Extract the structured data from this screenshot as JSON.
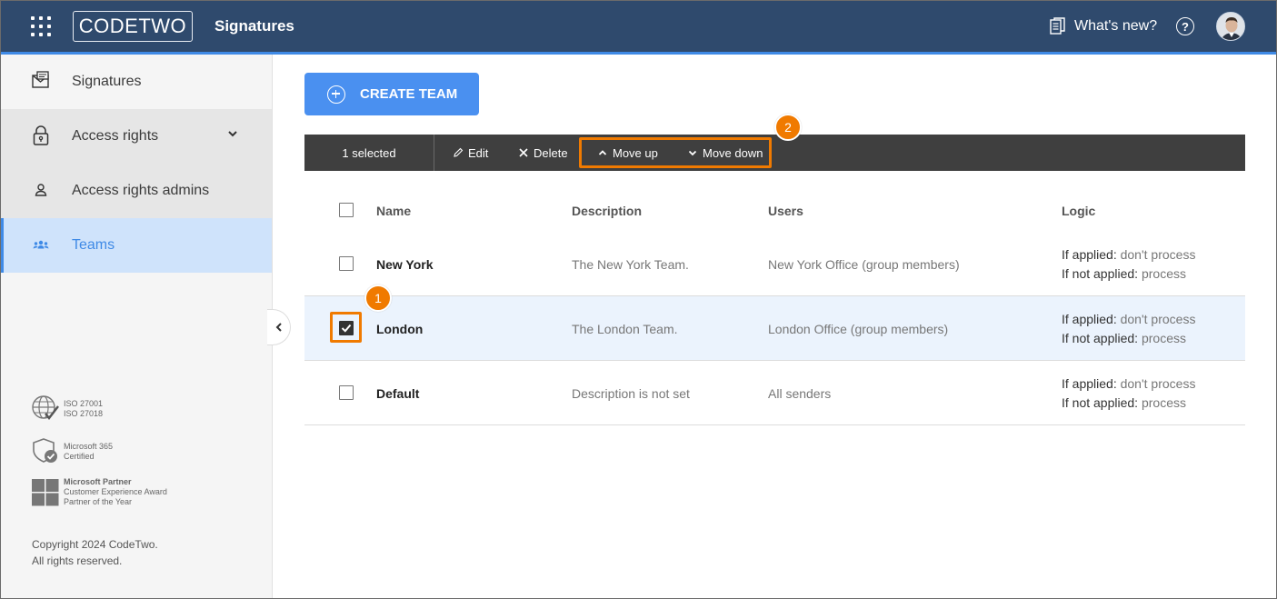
{
  "header": {
    "logo_text": "CODETWO",
    "app_title": "Signatures",
    "whats_new": "What's new?",
    "help_glyph": "?"
  },
  "sidebar": {
    "items": [
      {
        "label": "Signatures",
        "icon": "signature-icon"
      },
      {
        "label": "Access rights",
        "icon": "lock-icon"
      },
      {
        "label": "Access rights admins",
        "icon": "person-icon"
      },
      {
        "label": "Teams",
        "icon": "team-icon"
      }
    ],
    "badges": [
      {
        "lines": [
          "ISO 27001",
          "ISO 27018"
        ],
        "icon": "globe-check-icon"
      },
      {
        "lines": [
          "Microsoft 365",
          "Certified"
        ],
        "icon": "shield-check-icon"
      },
      {
        "lines": [
          "Microsoft Partner",
          "Customer Experience Award",
          "Partner of the Year"
        ],
        "icon": "microsoft-logo-icon"
      }
    ],
    "copyright_line1": "Copyright 2024 CodeTwo.",
    "copyright_line2": "All rights reserved."
  },
  "main": {
    "create_button": "CREATE TEAM",
    "toolbar": {
      "selected": "1 selected",
      "edit": "Edit",
      "delete": "Delete",
      "move_up": "Move up",
      "move_down": "Move down"
    },
    "callouts": [
      "1",
      "2"
    ],
    "table": {
      "columns": [
        "Name",
        "Description",
        "Users",
        "Logic"
      ],
      "rows": [
        {
          "name": "New York",
          "description": "The New York Team.",
          "users": "New York Office (group members)",
          "checked": false,
          "logic_applied_label": "If applied:",
          "logic_applied_value": "don't process",
          "logic_not_applied_label": "If not applied:",
          "logic_not_applied_value": "process"
        },
        {
          "name": "London",
          "description": "The London Team.",
          "users": "London Office (group members)",
          "checked": true,
          "logic_applied_label": "If applied:",
          "logic_applied_value": "don't process",
          "logic_not_applied_label": "If not applied:",
          "logic_not_applied_value": "process"
        },
        {
          "name": "Default",
          "description": "Description is not set",
          "users": "All senders",
          "checked": false,
          "logic_applied_label": "If applied:",
          "logic_applied_value": "don't process",
          "logic_not_applied_label": "If not applied:",
          "logic_not_applied_value": "process"
        }
      ]
    }
  },
  "colors": {
    "header_bg": "#2f4a6d",
    "accent": "#3f8ae6",
    "highlight": "#f07a00",
    "toolbar_bg": "#3f3f3f"
  }
}
